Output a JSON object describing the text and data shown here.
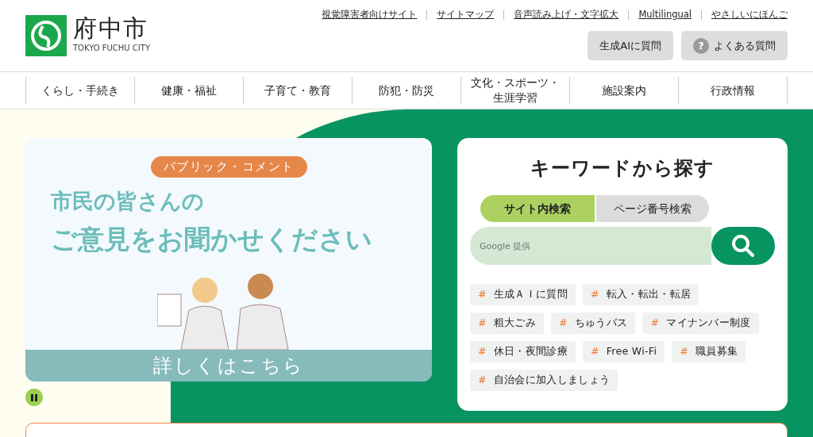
{
  "logo": {
    "name": "府中市",
    "subtitle": "TOKYO FUCHU CITY"
  },
  "utility_links": [
    "視覚障害者向けサイト",
    "サイトマップ",
    "音声読み上げ・文字拡大",
    "Multilingual",
    "やさしいにほんご"
  ],
  "header_buttons": [
    {
      "kind": "plain",
      "label": "生成AIに質問"
    },
    {
      "kind": "help",
      "icon": "?",
      "label": "よくある質問"
    }
  ],
  "nav": [
    {
      "lines": [
        "くらし・手続き"
      ]
    },
    {
      "lines": [
        "健康・福祉"
      ]
    },
    {
      "lines": [
        "子育て・教育"
      ]
    },
    {
      "lines": [
        "防犯・防災"
      ]
    },
    {
      "lines": [
        "文化・スポーツ・",
        "生涯学習"
      ]
    },
    {
      "lines": [
        "施設案内"
      ]
    },
    {
      "lines": [
        "行政情報"
      ]
    }
  ],
  "banner": {
    "badge": "パブリック・コメント",
    "headline_1": "市民の皆さんの",
    "headline_2": "ご意見をお聞かせください",
    "cta": "詳しくはこちら"
  },
  "search": {
    "title": "キーワードから探す",
    "tabs": [
      {
        "label": "サイト内検索",
        "selected": true
      },
      {
        "label": "ページ番号検索",
        "selected": false
      }
    ],
    "field": {
      "placeholder": "Google 提供"
    },
    "tags": [
      {
        "mark": "#",
        "label": "生成ＡＩに質問"
      },
      {
        "mark": "#",
        "label": "転入・転出・転居"
      },
      {
        "mark": "#",
        "label": "粗大ごみ"
      },
      {
        "mark": "#",
        "label": "ちゅうバス"
      },
      {
        "mark": "#",
        "label": "マイナンバー制度"
      },
      {
        "mark": "#",
        "label": "休日・夜間診療"
      },
      {
        "mark": "#",
        "label": "Free Wi-Fi"
      },
      {
        "mark": "#",
        "label": "職員募集"
      },
      {
        "mark": "#",
        "label": "自治会に加入しましょう"
      }
    ]
  }
}
